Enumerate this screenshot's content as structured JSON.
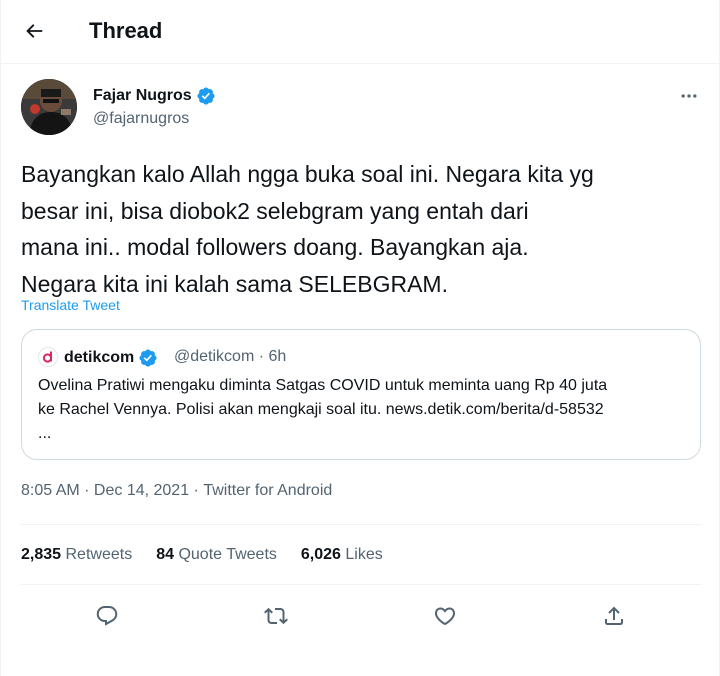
{
  "header": {
    "back_icon": "arrow-left-icon",
    "title": "Thread"
  },
  "tweet": {
    "author": {
      "name": "Fajar Nugros",
      "handle": "@fajarnugros",
      "verified": true,
      "verified_color": "#1d9bf0"
    },
    "text": "Bayangkan kalo Allah ngga buka soal ini. Negara kita yg\nbesar ini, bisa diobok2 selebgram yang entah dari\nmana ini.. modal followers doang. Bayangkan aja.\nNegara kita ini kalah sama SELEBGRAM.",
    "translate_label": "Translate Tweet",
    "quote": {
      "name": "detikcom",
      "handle_time": "@detikcom · 6h",
      "avatar_letter": "d",
      "brand_color": "#e0245e",
      "text": "Ovelina Pratiwi mengaku diminta Satgas COVID untuk meminta uang Rp 40 juta\nke Rachel Vennya. Polisi akan mengkaji soal itu. news.detik.com/berita/d-58532\n..."
    },
    "time": "8:05 AM",
    "date": "Dec 14, 2021",
    "separator": " · ",
    "source": "Twitter for Android",
    "stats": {
      "retweets": {
        "count": "2,835",
        "label": "Retweets"
      },
      "quotes": {
        "count": "84",
        "label": "Quote Tweets"
      },
      "likes": {
        "count": "6,026",
        "label": "Likes"
      }
    },
    "actions": [
      "reply-icon",
      "retweet-icon",
      "like-icon",
      "share-icon"
    ]
  },
  "colors": {
    "text": "#0f1419",
    "muted": "#536471",
    "link": "#1d9bf0",
    "border": "#cfd9de"
  }
}
